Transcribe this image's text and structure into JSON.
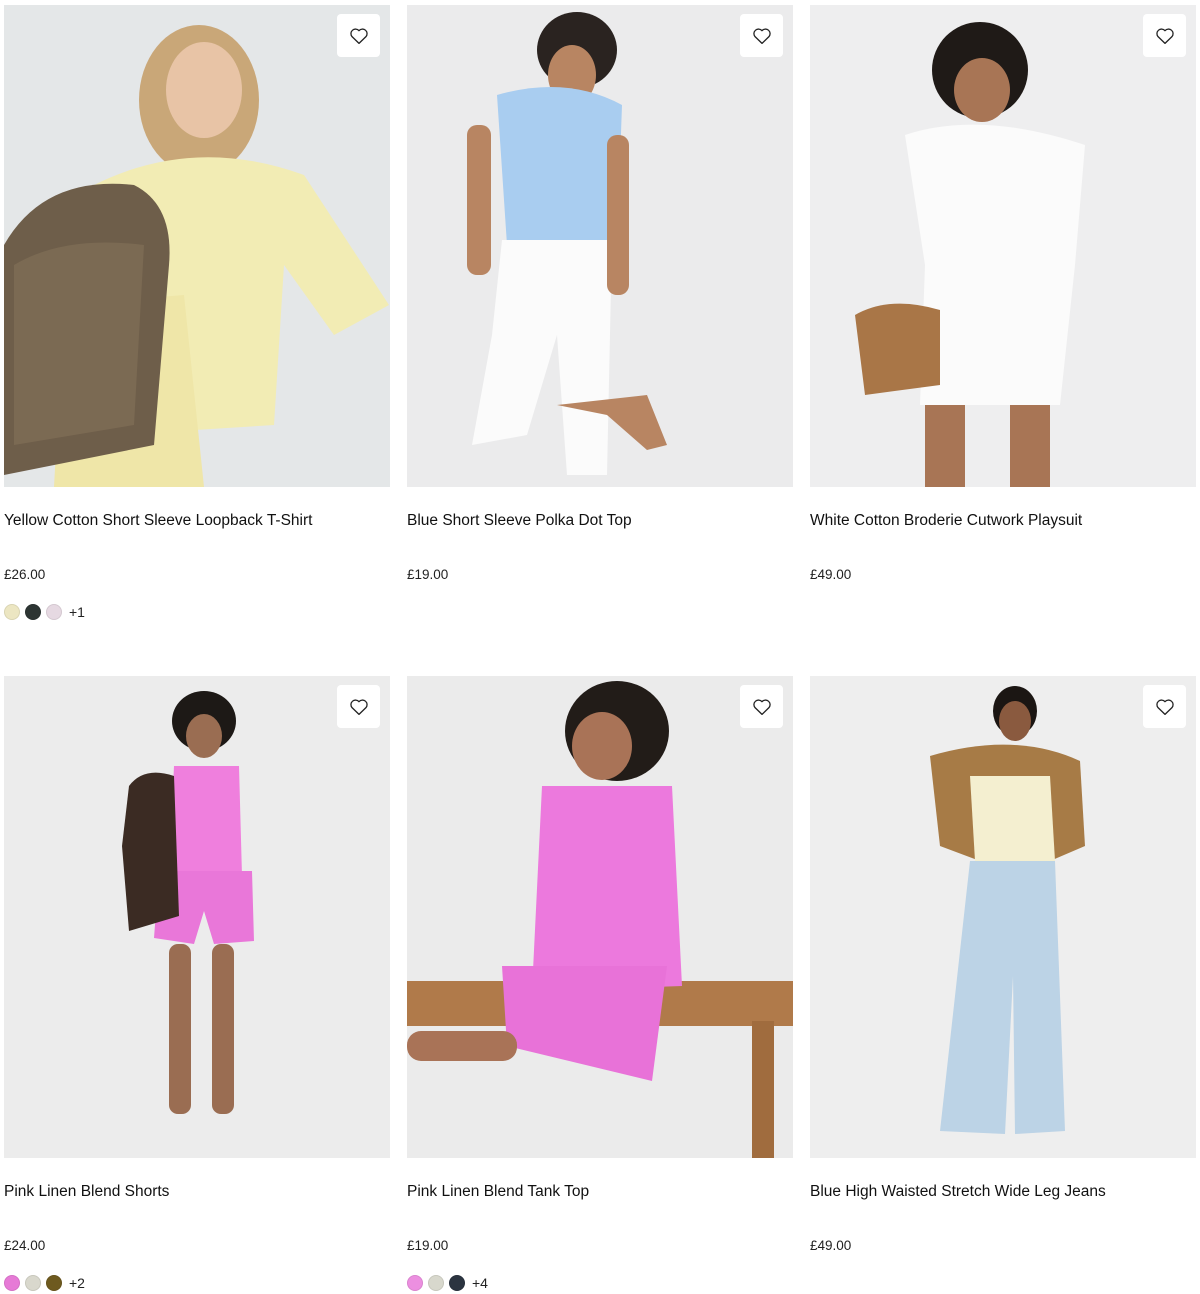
{
  "colors": {
    "wishlist_icon_stroke": "#222222",
    "price_text": "#222222"
  },
  "products": [
    {
      "title": "Yellow Cotton Short Sleeve Loopback T-Shirt",
      "price": "£26.00",
      "image_bg": "#e7e9ea",
      "swatches": [
        "#ece6c2",
        "#2d3533",
        "#e6d9e2"
      ],
      "more_colors": "+1"
    },
    {
      "title": "Blue Short Sleeve Polka Dot Top",
      "price": "£19.00",
      "image_bg": "#ebebec",
      "swatches": [],
      "more_colors": ""
    },
    {
      "title": "White Cotton Broderie Cutwork Playsuit",
      "price": "£49.00",
      "image_bg": "#eeeeef",
      "swatches": [],
      "more_colors": ""
    },
    {
      "title": "Pink Linen Blend Shorts",
      "price": "£24.00",
      "image_bg": "#ececec",
      "swatches": [
        "#e67ad6",
        "#d9d8cd",
        "#6e5a1f"
      ],
      "more_colors": "+2"
    },
    {
      "title": "Pink Linen Blend Tank Top",
      "price": "£19.00",
      "image_bg": "#ebebeb",
      "swatches": [
        "#ec8fe0",
        "#d8d8cd",
        "#2b3440"
      ],
      "more_colors": "+4"
    },
    {
      "title": "Blue High Waisted Stretch Wide Leg Jeans",
      "price": "£49.00",
      "image_bg": "#eeeeee",
      "swatches": [],
      "more_colors": ""
    }
  ]
}
